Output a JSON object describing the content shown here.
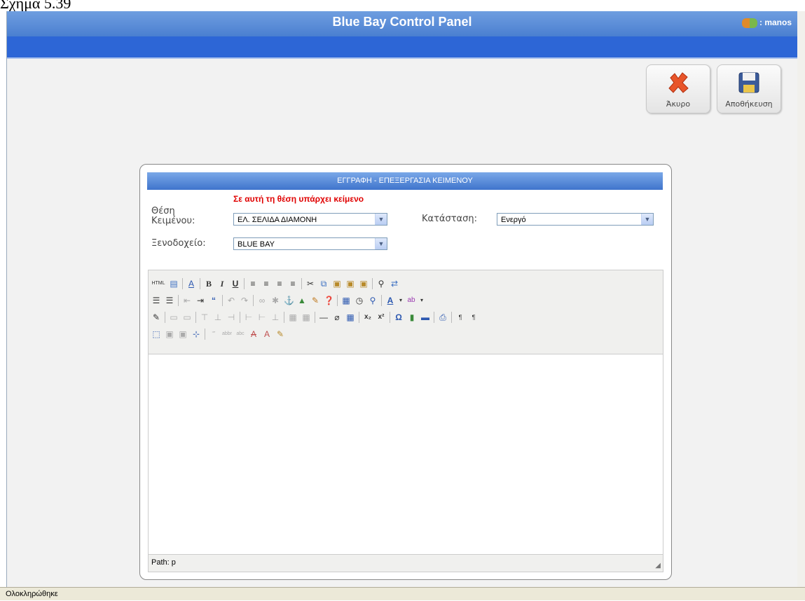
{
  "caption": "Σχήμα 5.39",
  "header": {
    "title": "Blue Bay Control Panel",
    "user": ": manos"
  },
  "toolbar": {
    "cancel_label": "Άκυρο",
    "save_label": "Αποθήκευση"
  },
  "panel": {
    "heading": "ΕΓΓΡΑΦΗ - ΕΠΕΞΕΡΓΑΣΙΑ ΚΕΙΜΕΝΟΥ",
    "warning": "Σε αυτή τη θέση υπάρχει κείμενο",
    "position_label_1": "Θέση",
    "position_label_2": "Κειμένου:",
    "position_value": "ΕΛ. ΣΕΛΙΔΑ ΔΙΑΜΟΝΗ",
    "status_label": "Κατάσταση:",
    "status_value": "Ενεργό",
    "hotel_label": "Ξενοδοχείο:",
    "hotel_value": "BLUE BAY"
  },
  "editor": {
    "path": "Path: p"
  },
  "statusbar": {
    "text": "Ολοκληρώθηκε"
  },
  "colors": {
    "header_blue": "#4a7fd0",
    "nav_blue": "#2d66d6",
    "warning_red": "#e00000"
  }
}
